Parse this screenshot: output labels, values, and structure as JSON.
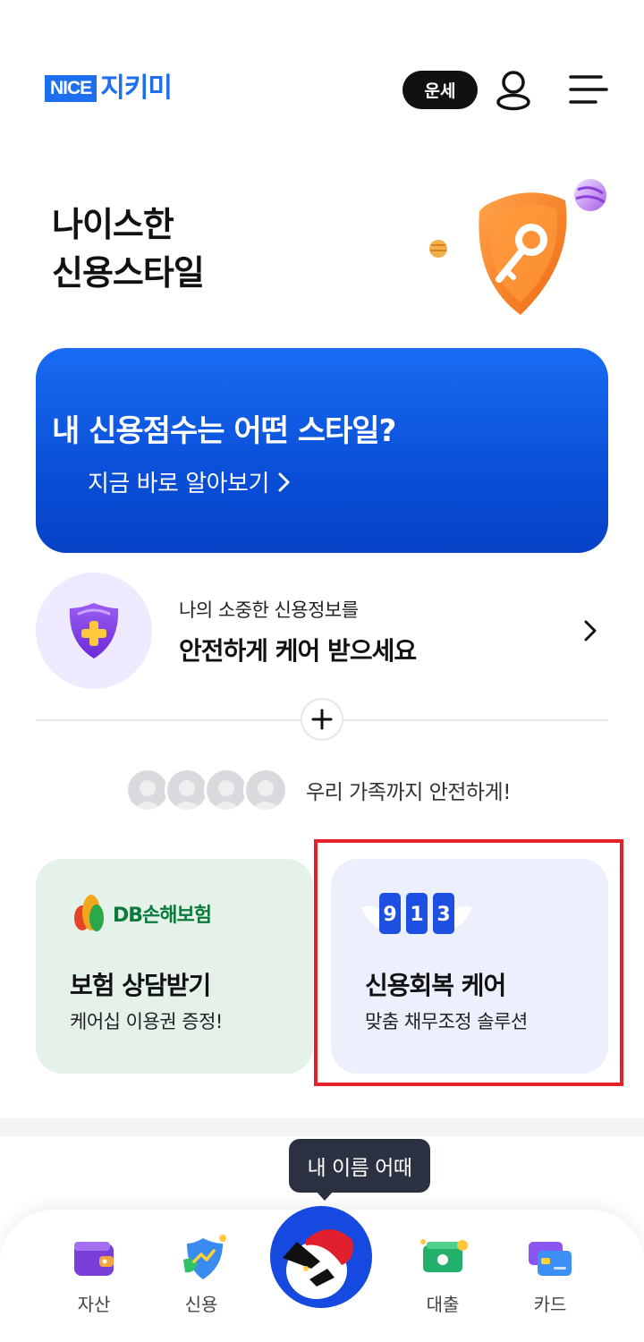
{
  "header": {
    "logo_nice": "NICE",
    "logo_kr": "지키미",
    "fortune_label": "운세"
  },
  "hero": {
    "title_line1": "나이스한",
    "title_line2": "신용스타일"
  },
  "banner": {
    "title": "내 신용점수는 어떤 스타일?",
    "link": "지금 바로 알아보기"
  },
  "care": {
    "subtitle": "나의 소중한 신용정보를",
    "title": "안전하게 케어 받으세요"
  },
  "family": {
    "text": "우리 가족까지 안전하게!"
  },
  "cards": [
    {
      "brand": "DB손해보험",
      "title": "보험 상담받기",
      "subtitle": "케어십 이용권 증정!"
    },
    {
      "digits": [
        "9",
        "1",
        "3"
      ],
      "title": "신용회복 케어",
      "subtitle": "맞춤 채무조정 솔루션"
    }
  ],
  "tooltip": "내 이름 어때",
  "nav": {
    "items": [
      {
        "label": "자산",
        "icon": "wallet-icon"
      },
      {
        "label": "신용",
        "icon": "credit-shield-icon"
      },
      {
        "label": "대출",
        "icon": "cash-icon"
      },
      {
        "label": "카드",
        "icon": "card-icon"
      }
    ]
  },
  "colors": {
    "brand_blue": "#1e6ff0",
    "banner_blue": "#0a4fd8",
    "highlight_red": "#e4202a",
    "db_green": "#0b7a3b"
  }
}
